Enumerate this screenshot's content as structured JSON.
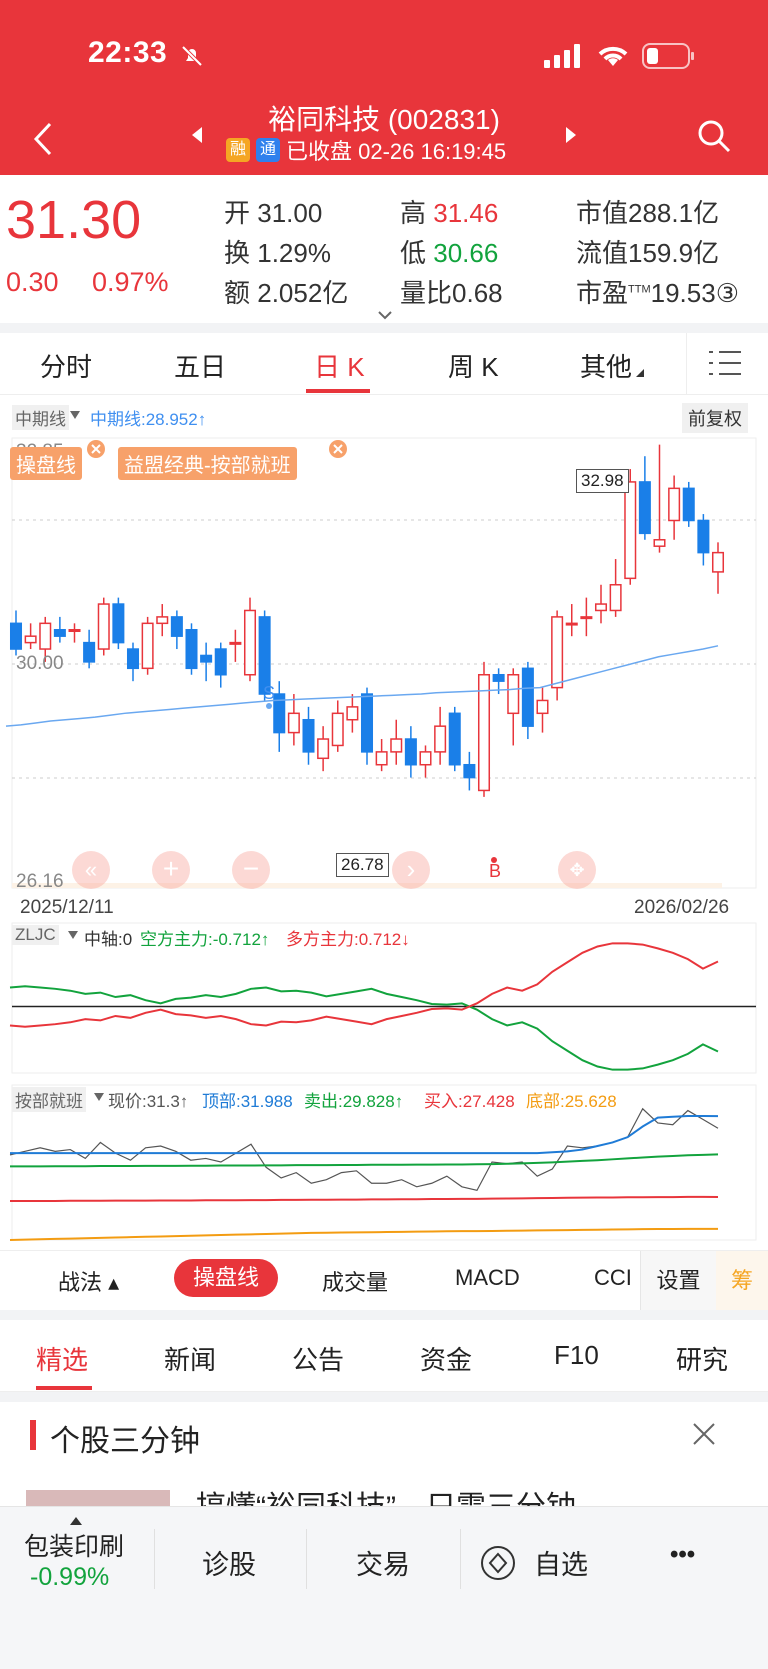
{
  "status": {
    "time": "22:33"
  },
  "header": {
    "title": "裕同科技 (002831)",
    "tag_rong": "融",
    "tag_tong": "通",
    "status_text": "已收盘 02-26 16:19:45"
  },
  "quote": {
    "price": "31.30",
    "change": "0.30",
    "change_pct": "0.97%",
    "open_label": "开",
    "open": "31.00",
    "high_label": "高",
    "high": "31.46",
    "cap_label": "市值",
    "cap": "288.1亿",
    "turnover_label": "换",
    "turnover": "1.29%",
    "low_label": "低",
    "low": "30.66",
    "float_label": "流值",
    "float_cap": "159.9亿",
    "amount_label": "额",
    "amount": "2.052亿",
    "vol_ratio_label": "量比",
    "vol_ratio": "0.68",
    "pe_label": "市盈",
    "pe_sup": "TTM",
    "pe": "19.53③"
  },
  "tabs": [
    "分时",
    "五日",
    "日 K",
    "周 K",
    "其他"
  ],
  "chart_header": {
    "indicator": "中期线",
    "value_text": "中期线:28.952↑",
    "adjust": "前复权"
  },
  "overlays": [
    "操盘线",
    "益盟经典-按部就班"
  ],
  "chart_labels": {
    "top": "32.85",
    "mid": "30.00",
    "bottom": "26.16",
    "high_tag": "32.98",
    "low_tag": "26.78",
    "start_date": "2025/12/11",
    "end_date": "2026/02/26",
    "s_mark": "S",
    "b_mark": "B"
  },
  "zljc": {
    "name": "ZLJC",
    "axis": "中轴:0",
    "short": "空方主力:-0.712↑",
    "long": "多方主力:0.712↓"
  },
  "abjb": {
    "name": "按部就班",
    "price": "现价:31.3↑",
    "top": "顶部:31.988",
    "sell": "卖出:29.828↑",
    "buy": "买入:27.428",
    "bottom": "底部:25.628"
  },
  "tools": [
    "战法 ▴",
    "操盘线",
    "成交量",
    "MACD",
    "CCI",
    "设置",
    "筹"
  ],
  "news_tabs": [
    "精选",
    "新闻",
    "公告",
    "资金",
    "F10",
    "研究"
  ],
  "section_title": "个股三分钟",
  "article_title": "搞懂“裕同科技”，只需三分钟",
  "bottom_bar": {
    "sector": "包装印刷",
    "sector_change": "-0.99%",
    "diagnose": "诊股",
    "trade": "交易",
    "watch": "自选",
    "more": "•••"
  },
  "colors": {
    "red": "#e8353b",
    "green": "#12a33d",
    "blue": "#3f8ff0",
    "orange": "#f39c12"
  },
  "chart_data": [
    {
      "type": "candlestick",
      "title": "日 K",
      "x_start": "2025/12/11",
      "x_end": "2026/02/26",
      "ylim": [
        26.16,
        32.85
      ],
      "candles": [
        {
          "o": 30.2,
          "c": 29.8,
          "h": 30.4,
          "l": 29.7
        },
        {
          "o": 29.9,
          "c": 30.0,
          "h": 30.2,
          "l": 29.8
        },
        {
          "o": 29.8,
          "c": 30.2,
          "h": 30.3,
          "l": 29.6
        },
        {
          "o": 30.1,
          "c": 30.0,
          "h": 30.3,
          "l": 29.9
        },
        {
          "o": 30.1,
          "c": 30.1,
          "h": 30.2,
          "l": 29.9
        },
        {
          "o": 29.9,
          "c": 29.6,
          "h": 30.1,
          "l": 29.5
        },
        {
          "o": 29.8,
          "c": 30.5,
          "h": 30.6,
          "l": 29.7
        },
        {
          "o": 30.5,
          "c": 29.9,
          "h": 30.6,
          "l": 29.8
        },
        {
          "o": 29.8,
          "c": 29.5,
          "h": 29.9,
          "l": 29.3
        },
        {
          "o": 29.5,
          "c": 30.2,
          "h": 30.3,
          "l": 29.4
        },
        {
          "o": 30.2,
          "c": 30.3,
          "h": 30.5,
          "l": 30.0
        },
        {
          "o": 30.3,
          "c": 30.0,
          "h": 30.4,
          "l": 29.8
        },
        {
          "o": 30.1,
          "c": 29.5,
          "h": 30.2,
          "l": 29.4
        },
        {
          "o": 29.7,
          "c": 29.6,
          "h": 29.9,
          "l": 29.3
        },
        {
          "o": 29.8,
          "c": 29.4,
          "h": 29.9,
          "l": 29.2
        },
        {
          "o": 29.9,
          "c": 29.9,
          "h": 30.1,
          "l": 29.6
        },
        {
          "o": 29.4,
          "c": 30.4,
          "h": 30.6,
          "l": 29.3
        },
        {
          "o": 30.3,
          "c": 29.1,
          "h": 30.4,
          "l": 29.0
        },
        {
          "o": 29.1,
          "c": 28.5,
          "h": 29.3,
          "l": 28.2
        },
        {
          "o": 28.5,
          "c": 28.8,
          "h": 29.1,
          "l": 28.3
        },
        {
          "o": 28.7,
          "c": 28.2,
          "h": 28.9,
          "l": 28.0
        },
        {
          "o": 28.1,
          "c": 28.4,
          "h": 28.6,
          "l": 27.9
        },
        {
          "o": 28.3,
          "c": 28.8,
          "h": 29.0,
          "l": 28.2
        },
        {
          "o": 28.7,
          "c": 28.9,
          "h": 29.1,
          "l": 28.5
        },
        {
          "o": 29.1,
          "c": 28.2,
          "h": 29.2,
          "l": 28.0
        },
        {
          "o": 28.0,
          "c": 28.2,
          "h": 28.4,
          "l": 27.9
        },
        {
          "o": 28.2,
          "c": 28.4,
          "h": 28.7,
          "l": 28.0
        },
        {
          "o": 28.4,
          "c": 28.0,
          "h": 28.6,
          "l": 27.8
        },
        {
          "o": 28.0,
          "c": 28.2,
          "h": 28.3,
          "l": 27.8
        },
        {
          "o": 28.2,
          "c": 28.6,
          "h": 28.9,
          "l": 28.0
        },
        {
          "o": 28.8,
          "c": 28.0,
          "h": 28.9,
          "l": 27.9
        },
        {
          "o": 28.0,
          "c": 27.8,
          "h": 28.2,
          "l": 27.6
        },
        {
          "o": 27.6,
          "c": 29.4,
          "h": 29.6,
          "l": 27.5
        },
        {
          "o": 29.4,
          "c": 29.3,
          "h": 29.5,
          "l": 29.1
        },
        {
          "o": 28.8,
          "c": 29.4,
          "h": 29.5,
          "l": 28.3
        },
        {
          "o": 29.5,
          "c": 28.6,
          "h": 29.6,
          "l": 28.4
        },
        {
          "o": 28.8,
          "c": 29.0,
          "h": 29.2,
          "l": 28.5
        },
        {
          "o": 29.2,
          "c": 30.3,
          "h": 30.4,
          "l": 29.0
        },
        {
          "o": 30.2,
          "c": 30.2,
          "h": 30.5,
          "l": 30.0
        },
        {
          "o": 30.3,
          "c": 30.3,
          "h": 30.6,
          "l": 30.0
        },
        {
          "o": 30.4,
          "c": 30.5,
          "h": 30.8,
          "l": 30.2
        },
        {
          "o": 30.4,
          "c": 30.8,
          "h": 31.2,
          "l": 30.3
        },
        {
          "o": 30.9,
          "c": 32.4,
          "h": 32.6,
          "l": 30.8
        },
        {
          "o": 32.4,
          "c": 31.6,
          "h": 32.8,
          "l": 31.5
        },
        {
          "o": 31.4,
          "c": 31.5,
          "h": 32.98,
          "l": 31.3
        },
        {
          "o": 31.8,
          "c": 32.3,
          "h": 32.5,
          "l": 31.5
        },
        {
          "o": 32.3,
          "c": 31.8,
          "h": 32.4,
          "l": 31.7
        },
        {
          "o": 31.8,
          "c": 31.3,
          "h": 31.9,
          "l": 31.1
        },
        {
          "o": 31.0,
          "c": 31.3,
          "h": 31.46,
          "l": 30.66
        }
      ],
      "series": [
        {
          "name": "中期线",
          "values": [
            28.6,
            28.62,
            28.65,
            28.68,
            28.7,
            28.72,
            28.74,
            28.77,
            28.8,
            28.82,
            28.84,
            28.86,
            28.88,
            28.9,
            28.92,
            28.94,
            28.96,
            28.98,
            29.0,
            29.01,
            29.02,
            29.03,
            29.04,
            29.05,
            29.06,
            29.07,
            29.08,
            29.09,
            29.1,
            29.12,
            29.13,
            29.14,
            29.15,
            29.16,
            29.17,
            29.19,
            29.2,
            29.26,
            29.32,
            29.38,
            29.44,
            29.5,
            29.56,
            29.62,
            29.68,
            29.72,
            29.76,
            29.8,
            29.85
          ]
        }
      ]
    },
    {
      "type": "line",
      "title": "ZLJC",
      "ylim": [
        -1,
        1
      ],
      "series": [
        {
          "name": "空方主力",
          "values": [
            0.3,
            0.32,
            0.3,
            0.28,
            0.25,
            0.2,
            0.22,
            0.15,
            0.18,
            0.1,
            0.05,
            0.12,
            0.14,
            0.18,
            0.15,
            0.2,
            0.28,
            0.3,
            0.24,
            0.25,
            0.22,
            0.16,
            0.2,
            0.24,
            0.28,
            0.2,
            0.15,
            0.1,
            0.04,
            0.03,
            0.05,
            -0.05,
            -0.2,
            -0.3,
            -0.25,
            -0.35,
            -0.55,
            -0.7,
            -0.85,
            -0.95,
            -1.0,
            -1.0,
            -0.98,
            -0.92,
            -0.85,
            -0.75,
            -0.6,
            -0.712
          ]
        },
        {
          "name": "多方主力",
          "values": [
            -0.3,
            -0.32,
            -0.3,
            -0.28,
            -0.25,
            -0.2,
            -0.22,
            -0.15,
            -0.18,
            -0.1,
            -0.05,
            -0.12,
            -0.14,
            -0.18,
            -0.15,
            -0.2,
            -0.28,
            -0.3,
            -0.24,
            -0.25,
            -0.22,
            -0.16,
            -0.2,
            -0.24,
            -0.28,
            -0.2,
            -0.15,
            -0.1,
            -0.04,
            -0.03,
            -0.05,
            0.05,
            0.2,
            0.3,
            0.25,
            0.35,
            0.55,
            0.7,
            0.85,
            0.95,
            1.0,
            1.0,
            0.98,
            0.92,
            0.85,
            0.75,
            0.6,
            0.712
          ]
        }
      ]
    },
    {
      "type": "line",
      "title": "按部就班",
      "ylim": [
        25.0,
        32.5
      ],
      "series": [
        {
          "name": "现价",
          "values": [
            29.8,
            30.0,
            30.2,
            30.0,
            30.1,
            29.6,
            30.5,
            29.9,
            29.5,
            30.2,
            30.3,
            30.0,
            29.5,
            29.6,
            29.4,
            29.9,
            30.4,
            29.1,
            28.5,
            28.8,
            28.2,
            28.4,
            28.8,
            28.9,
            28.2,
            28.2,
            28.4,
            28.0,
            28.2,
            28.6,
            28.0,
            27.8,
            29.4,
            29.3,
            29.4,
            28.6,
            29.0,
            30.3,
            30.2,
            30.3,
            30.5,
            30.8,
            32.4,
            31.6,
            31.5,
            32.3,
            31.8,
            31.3
          ]
        },
        {
          "name": "顶部",
          "values": [
            29.9,
            29.9,
            29.9,
            29.9,
            29.9,
            29.9,
            29.9,
            29.9,
            29.9,
            29.9,
            29.9,
            29.9,
            29.9,
            29.9,
            29.9,
            29.9,
            29.9,
            29.9,
            29.9,
            29.9,
            29.9,
            29.9,
            29.9,
            29.9,
            29.9,
            29.9,
            29.9,
            29.9,
            29.9,
            29.9,
            29.9,
            29.9,
            29.9,
            29.9,
            29.9,
            29.9,
            29.95,
            30.0,
            30.1,
            30.3,
            30.5,
            30.8,
            31.4,
            31.9,
            31.95,
            31.99,
            31.99,
            31.988
          ]
        },
        {
          "name": "卖出",
          "values": [
            29.15,
            29.15,
            29.15,
            29.16,
            29.16,
            29.16,
            29.17,
            29.17,
            29.17,
            29.18,
            29.18,
            29.18,
            29.19,
            29.19,
            29.2,
            29.2,
            29.2,
            29.21,
            29.21,
            29.22,
            29.22,
            29.22,
            29.23,
            29.23,
            29.24,
            29.24,
            29.24,
            29.25,
            29.25,
            29.26,
            29.26,
            29.27,
            29.28,
            29.3,
            29.32,
            29.35,
            29.38,
            29.42,
            29.46,
            29.5,
            29.55,
            29.6,
            29.65,
            29.7,
            29.74,
            29.78,
            29.8,
            29.828
          ]
        },
        {
          "name": "买入",
          "values": [
            27.2,
            27.2,
            27.2,
            27.2,
            27.21,
            27.21,
            27.21,
            27.22,
            27.22,
            27.22,
            27.23,
            27.23,
            27.23,
            27.24,
            27.24,
            27.24,
            27.25,
            27.25,
            27.26,
            27.26,
            27.27,
            27.27,
            27.28,
            27.28,
            27.29,
            27.29,
            27.3,
            27.3,
            27.31,
            27.31,
            27.32,
            27.32,
            27.33,
            27.34,
            27.35,
            27.36,
            27.37,
            27.38,
            27.39,
            27.4,
            27.4,
            27.41,
            27.41,
            27.42,
            27.42,
            27.43,
            27.43,
            27.428
          ]
        },
        {
          "name": "底部",
          "values": [
            25.0,
            25.02,
            25.04,
            25.06,
            25.08,
            25.1,
            25.12,
            25.14,
            25.16,
            25.18,
            25.2,
            25.22,
            25.24,
            25.26,
            25.28,
            25.3,
            25.32,
            25.34,
            25.36,
            25.38,
            25.4,
            25.41,
            25.42,
            25.43,
            25.44,
            25.45,
            25.46,
            25.47,
            25.48,
            25.49,
            25.5,
            25.5,
            25.51,
            25.52,
            25.53,
            25.54,
            25.55,
            25.56,
            25.57,
            25.58,
            25.59,
            25.6,
            25.61,
            25.62,
            25.62,
            25.63,
            25.63,
            25.628
          ]
        }
      ]
    }
  ]
}
